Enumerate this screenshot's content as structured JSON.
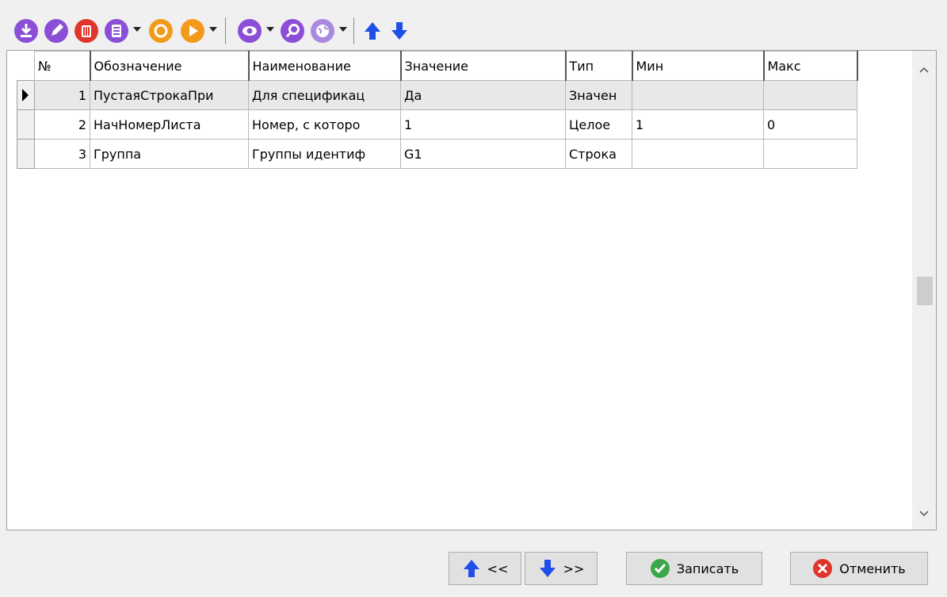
{
  "toolbar": {
    "icons": [
      "download-icon",
      "edit-icon",
      "delete-icon",
      "list-icon",
      "refresh-icon",
      "play-icon",
      "view-icon",
      "search-icon",
      "globe-icon",
      "arrow-up-icon",
      "arrow-down-icon"
    ]
  },
  "grid": {
    "columns": [
      "№",
      "Обозначение",
      "Наименование",
      "Значение",
      "Тип",
      "Мин",
      "Макс"
    ],
    "rows": [
      {
        "num": "1",
        "code": "ПустаяСтрокаПри",
        "name": "Для спецификац",
        "value": "Да",
        "type": "Значен",
        "min": "",
        "max": ""
      },
      {
        "num": "2",
        "code": "НачНомерЛиста",
        "name": "Номер, с которо",
        "value": "1",
        "type": "Целое",
        "min": "1",
        "max": "0"
      },
      {
        "num": "3",
        "code": "Группа",
        "name": "Группы идентиф",
        "value": "G1",
        "type": "Строка",
        "min": "",
        "max": ""
      }
    ],
    "selected_row": 1
  },
  "footer": {
    "prev_label": "<<",
    "next_label": ">>",
    "save_label": "Записать",
    "cancel_label": "Отменить"
  },
  "colors": {
    "purple": "#8a4fd6",
    "red": "#e0352b",
    "orange": "#f29a1b",
    "blue_arrow": "#1f4fe8",
    "green": "#3aa84a"
  }
}
